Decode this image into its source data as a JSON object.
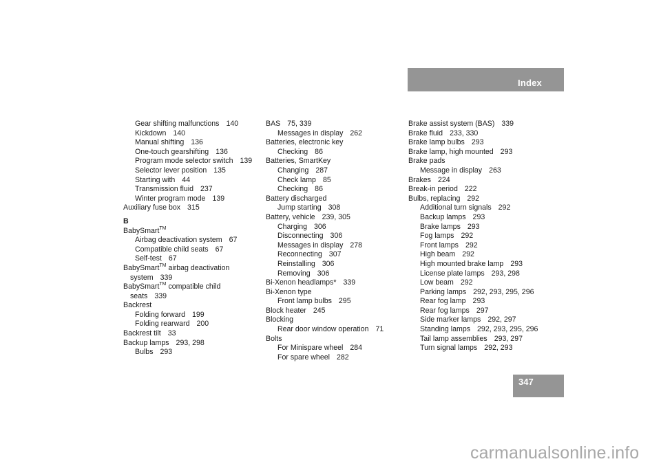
{
  "header": {
    "title": "Index",
    "band_color": "#959595"
  },
  "page_number": "347",
  "columns": [
    {
      "entries": [
        {
          "type": "sub",
          "text": "Gear shifting malfunctions",
          "pages": "140"
        },
        {
          "type": "sub",
          "text": "Kickdown",
          "pages": "140"
        },
        {
          "type": "sub",
          "text": "Manual shifting",
          "pages": "136"
        },
        {
          "type": "sub",
          "text": "One-touch gearshifting",
          "pages": "136"
        },
        {
          "type": "sub",
          "text": "Program mode selector switch",
          "pages": "139"
        },
        {
          "type": "sub",
          "text": "Selector lever position",
          "pages": "135"
        },
        {
          "type": "sub",
          "text": "Starting with",
          "pages": "44"
        },
        {
          "type": "sub",
          "text": "Transmission fluid",
          "pages": "237"
        },
        {
          "type": "sub",
          "text": "Winter program mode",
          "pages": "139"
        },
        {
          "type": "main",
          "text": "Auxiliary fuse box",
          "pages": "315"
        },
        {
          "type": "letter",
          "text": "B"
        },
        {
          "type": "main",
          "text": "BabySmart",
          "tm": "TM",
          "after": "",
          "pages": ""
        },
        {
          "type": "sub",
          "text": "Airbag deactivation system",
          "pages": "67"
        },
        {
          "type": "sub",
          "text": "Compatible child seats",
          "pages": "67"
        },
        {
          "type": "sub",
          "text": "Self-test",
          "pages": "67"
        },
        {
          "type": "main",
          "text": "BabySmart",
          "tm": "TM",
          "after": " airbag deactivation",
          "pages": ""
        },
        {
          "type": "cont",
          "text": "system",
          "pages": "339"
        },
        {
          "type": "main",
          "text": "BabySmart",
          "tm": "TM",
          "after": " compatible child",
          "pages": ""
        },
        {
          "type": "cont",
          "text": "seats",
          "pages": "339"
        },
        {
          "type": "main",
          "text": "Backrest",
          "pages": ""
        },
        {
          "type": "sub",
          "text": "Folding forward",
          "pages": "199"
        },
        {
          "type": "sub",
          "text": "Folding rearward",
          "pages": "200"
        },
        {
          "type": "main",
          "text": "Backrest tilt",
          "pages": "33"
        },
        {
          "type": "main",
          "text": "Backup lamps",
          "pages": "293, 298"
        },
        {
          "type": "sub",
          "text": "Bulbs",
          "pages": "293"
        }
      ]
    },
    {
      "entries": [
        {
          "type": "main",
          "text": "BAS",
          "pages": "75, 339"
        },
        {
          "type": "sub",
          "text": "Messages in display",
          "pages": "262"
        },
        {
          "type": "main",
          "text": "Batteries, electronic key",
          "pages": ""
        },
        {
          "type": "sub",
          "text": "Checking",
          "pages": "86"
        },
        {
          "type": "main",
          "text": "Batteries, SmartKey",
          "pages": ""
        },
        {
          "type": "sub",
          "text": "Changing",
          "pages": "287"
        },
        {
          "type": "sub",
          "text": "Check lamp",
          "pages": "85"
        },
        {
          "type": "sub",
          "text": "Checking",
          "pages": "86"
        },
        {
          "type": "main",
          "text": "Battery discharged",
          "pages": ""
        },
        {
          "type": "sub",
          "text": "Jump starting",
          "pages": "308"
        },
        {
          "type": "main",
          "text": "Battery, vehicle",
          "pages": "239, 305"
        },
        {
          "type": "sub",
          "text": "Charging",
          "pages": "306"
        },
        {
          "type": "sub",
          "text": "Disconnecting",
          "pages": "306"
        },
        {
          "type": "sub",
          "text": "Messages in display",
          "pages": "278"
        },
        {
          "type": "sub",
          "text": "Reconnecting",
          "pages": "307"
        },
        {
          "type": "sub",
          "text": "Reinstalling",
          "pages": "306"
        },
        {
          "type": "sub",
          "text": "Removing",
          "pages": "306"
        },
        {
          "type": "main",
          "text": "Bi-Xenon headlamps*",
          "pages": "339"
        },
        {
          "type": "main",
          "text": "Bi-Xenon type",
          "pages": ""
        },
        {
          "type": "sub",
          "text": "Front lamp bulbs",
          "pages": "295"
        },
        {
          "type": "main",
          "text": "Block heater",
          "pages": "245"
        },
        {
          "type": "main",
          "text": "Blocking",
          "pages": ""
        },
        {
          "type": "sub",
          "text": "Rear door window operation",
          "pages": "71"
        },
        {
          "type": "main",
          "text": "Bolts",
          "pages": ""
        },
        {
          "type": "sub",
          "text": "For Minispare wheel",
          "pages": "284"
        },
        {
          "type": "sub",
          "text": "For spare wheel",
          "pages": "282"
        }
      ]
    },
    {
      "entries": [
        {
          "type": "main",
          "text": "Brake assist system (BAS)",
          "pages": "339"
        },
        {
          "type": "main",
          "text": "Brake fluid",
          "pages": "233, 330"
        },
        {
          "type": "main",
          "text": "Brake lamp bulbs",
          "pages": "293"
        },
        {
          "type": "main",
          "text": "Brake lamp, high mounted",
          "pages": "293"
        },
        {
          "type": "main",
          "text": "Brake pads",
          "pages": ""
        },
        {
          "type": "sub",
          "text": "Message in display",
          "pages": "263"
        },
        {
          "type": "main",
          "text": "Brakes",
          "pages": "224"
        },
        {
          "type": "main",
          "text": "Break-in period",
          "pages": "222"
        },
        {
          "type": "main",
          "text": "Bulbs, replacing",
          "pages": "292"
        },
        {
          "type": "sub",
          "text": "Additional turn signals",
          "pages": "292"
        },
        {
          "type": "sub",
          "text": "Backup lamps",
          "pages": "293"
        },
        {
          "type": "sub",
          "text": "Brake lamps",
          "pages": "293"
        },
        {
          "type": "sub",
          "text": "Fog lamps",
          "pages": "292"
        },
        {
          "type": "sub",
          "text": "Front lamps",
          "pages": "292"
        },
        {
          "type": "sub",
          "text": "High beam",
          "pages": "292"
        },
        {
          "type": "sub",
          "text": "High mounted brake lamp",
          "pages": "293"
        },
        {
          "type": "sub",
          "text": "License plate lamps",
          "pages": "293, 298"
        },
        {
          "type": "sub",
          "text": "Low beam",
          "pages": "292"
        },
        {
          "type": "sub",
          "text": "Parking lamps",
          "pages": "292, 293, 295, 296"
        },
        {
          "type": "sub",
          "text": "Rear fog lamp",
          "pages": "293"
        },
        {
          "type": "sub",
          "text": "Rear fog lamps",
          "pages": "297"
        },
        {
          "type": "sub",
          "text": "Side marker lamps",
          "pages": "292, 297"
        },
        {
          "type": "sub",
          "text": "Standing lamps",
          "pages": "292, 293, 295, 296"
        },
        {
          "type": "sub",
          "text": "Tail lamp assemblies",
          "pages": "293, 297"
        },
        {
          "type": "sub",
          "text": "Turn signal lamps",
          "pages": "292, 293"
        }
      ]
    }
  ],
  "watermark": "carmanualsonline.info"
}
